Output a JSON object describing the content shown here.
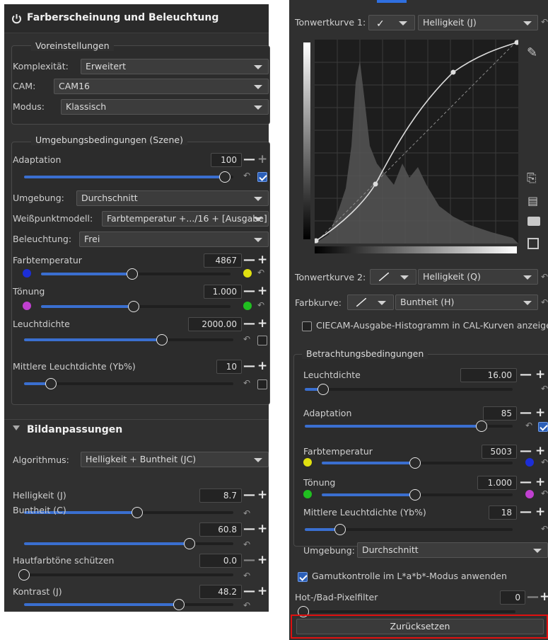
{
  "left": {
    "title": "Farberscheinung und Beleuchtung",
    "presets": {
      "legend": "Voreinstellungen",
      "complexity_label": "Komplexität:",
      "complexity_value": "Erweitert",
      "cam_label": "CAM:",
      "cam_value": "CAM16",
      "mode_label": "Modus:",
      "mode_value": "Klassisch"
    },
    "scene": {
      "legend": "Umgebungsbedingungen (Szene)",
      "adaptation_label": "Adaptation",
      "adaptation_value": "100",
      "adaptation_level": 0.96,
      "surround_label": "Umgebung:",
      "surround_value": "Durchschnitt",
      "wp_label": "Weißpunktmodell:",
      "wp_value": "Farbtemperatur +.../16 + [Ausgabe]",
      "illum_label": "Beleuchtung:",
      "illum_value": "Frei",
      "temp_label": "Farbtemperatur",
      "temp_value": "4867",
      "temp_level": 0.48,
      "tint_label": "Tönung",
      "tint_value": "1.000",
      "tint_level": 0.49,
      "lum_label": "Leuchtdichte",
      "lum_value": "2000.00",
      "lum_level": 0.66,
      "yb_label": "Mittlere Leuchtdichte (Yb%)",
      "yb_value": "10",
      "yb_level": 0.13
    },
    "image": {
      "header": "Bildanpassungen",
      "algo_label": "Algorithmus:",
      "algo_value": "Helligkeit + Buntheit (JC)",
      "j_label": "Helligkeit (J)",
      "j_value": "8.7",
      "j_level": 0.54,
      "c_label": "Buntheit (C)",
      "c_value": "60.8",
      "c_level": 0.79,
      "skin_label": "Hautfarbtöne schützen",
      "skin_value": "0.0",
      "skin_level": 0.0,
      "contrast_label": "Kontrast (J)",
      "contrast_value": "48.2",
      "contrast_level": 0.74
    }
  },
  "right": {
    "curve1_label": "Tonwertkurve 1:",
    "curve1_channel": "Helligkeit (J)",
    "curve2_label": "Tonwertkurve 2:",
    "curve2_channel": "Helligkeit (Q)",
    "color_label": "Farbkurve:",
    "color_channel": "Buntheit (H)",
    "histo_label": "CIECAM-Ausgabe-Histogramm in CAL-Kurven anzeigen",
    "viewing": {
      "legend": "Betrachtungsbedingungen",
      "lum_label": "Leuchtdichte",
      "lum_value": "16.00",
      "lum_level": 0.09,
      "adapt_label": "Adaptation",
      "adapt_value": "85",
      "adapt_level": 0.85,
      "temp_label": "Farbtemperatur",
      "temp_value": "5003",
      "temp_level": 0.49,
      "tint_label": "Tönung",
      "tint_value": "1.000",
      "tint_level": 0.49,
      "yb_label": "Mittlere Leuchtdichte (Yb%)",
      "yb_value": "18",
      "yb_level": 0.17,
      "surround_label": "Umgebung:",
      "surround_value": "Durchschnitt"
    },
    "gamut_label": "Gamutkontrolle im L*a*b*-Modus anwenden",
    "hotbad_label": "Hot-/Bad-Pixelfilter",
    "hotbad_value": "0",
    "reset_label": "Zurücksetzen"
  },
  "colors": {
    "accent": "#3a6fd0",
    "highlight_border": "#e01010"
  }
}
